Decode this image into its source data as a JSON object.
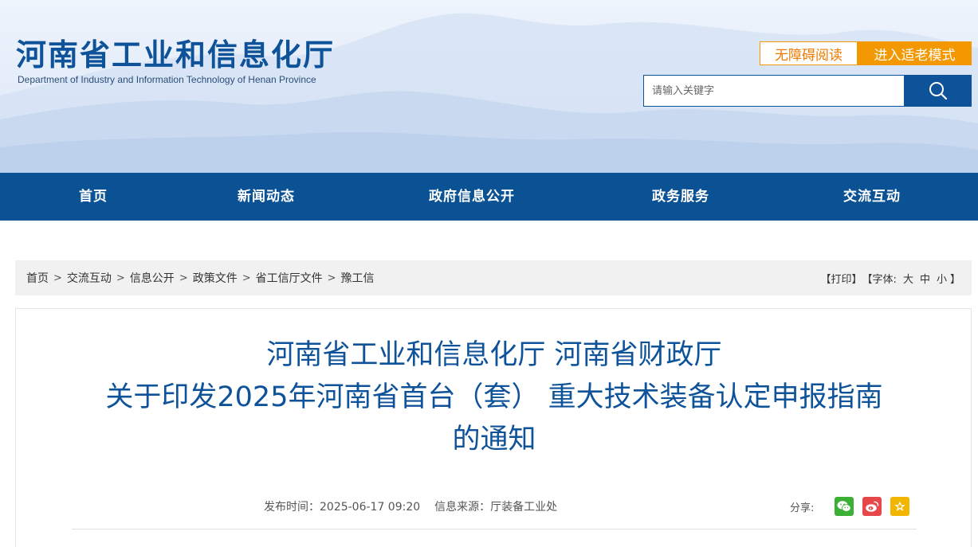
{
  "header": {
    "title": "河南省工业和信息化厅",
    "subtitle": "Department of Industry and Information Technology of Henan Province",
    "accessibility_label": "无障碍阅读",
    "elder_mode_label": "进入适老模式",
    "search_placeholder": "请输入关键字",
    "search_icon": "search-icon"
  },
  "nav": {
    "items": [
      {
        "label": "首页"
      },
      {
        "label": "新闻动态"
      },
      {
        "label": "政府信息公开"
      },
      {
        "label": "政务服务"
      },
      {
        "label": "交流互动"
      }
    ]
  },
  "breadcrumb": {
    "items": [
      "首页",
      "交流互动",
      "信息公开",
      "政策文件",
      "省工信厅文件",
      "豫工信"
    ],
    "separator": ">"
  },
  "tools": {
    "print_label": "【打印】",
    "font_prefix": "【字体:",
    "font_large": "大",
    "font_medium": "中",
    "font_small": "小",
    "font_suffix": "】"
  },
  "article": {
    "title_lines": [
      "河南省工业和信息化厅 河南省财政厅",
      "关于印发2025年河南省首台（套） 重大技术装备认定申报指南",
      "的通知"
    ],
    "publish_time": "发布时间：2025-06-17 09:20",
    "source": "信息来源：厅装备工业处",
    "share_label": "分享:",
    "share_icons": [
      "wechat-icon",
      "weibo-icon",
      "favorite-icon"
    ]
  },
  "colors": {
    "brand_blue": "#0e5399",
    "nav_blue": "#0b5294",
    "orange": "#f39800",
    "wechat_green": "#3cb034",
    "weibo_red": "#e6474a",
    "star_yellow": "#f3b600"
  }
}
